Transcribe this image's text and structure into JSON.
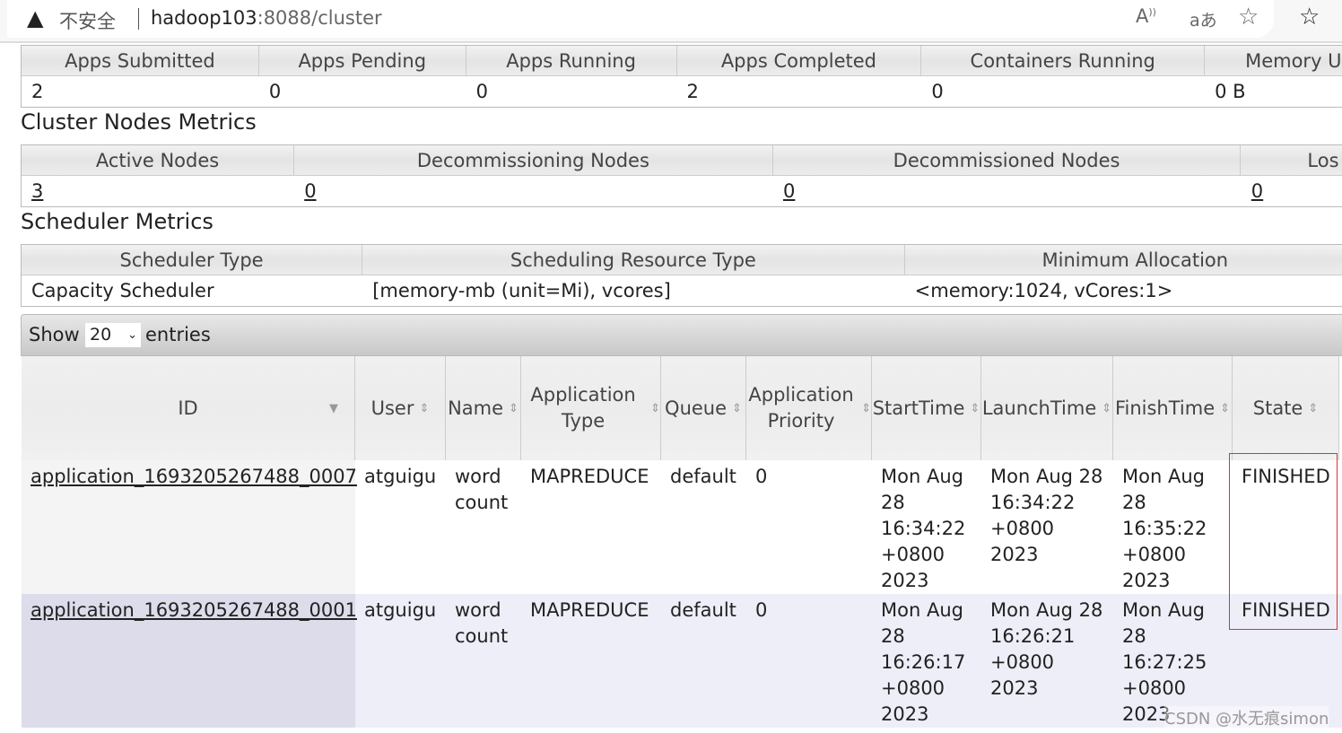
{
  "browser": {
    "security_warning": "不安全",
    "url_host": "hadoop103",
    "url_path": ":8088/cluster",
    "icons": [
      "warning-icon",
      "read-aloud-icon",
      "translate-icon",
      "add-favorite-icon",
      "favorites-icon"
    ]
  },
  "cluster_metrics": {
    "headers": [
      "Apps Submitted",
      "Apps Pending",
      "Apps Running",
      "Apps Completed",
      "Containers Running",
      "Memory U"
    ],
    "values": [
      "2",
      "0",
      "0",
      "2",
      "0",
      "0 B"
    ]
  },
  "nodes_metrics": {
    "title": "Cluster Nodes Metrics",
    "headers": [
      "Active Nodes",
      "Decommissioning Nodes",
      "Decommissioned Nodes",
      "Los"
    ],
    "values": [
      "3",
      "0",
      "0",
      "0"
    ]
  },
  "scheduler_metrics": {
    "title": "Scheduler Metrics",
    "headers": [
      "Scheduler Type",
      "Scheduling Resource Type",
      "Minimum Allocation"
    ],
    "values": [
      "Capacity Scheduler",
      "[memory-mb (unit=Mi), vcores]",
      "<memory:1024, vCores:1>"
    ]
  },
  "entries": {
    "show_label": "Show",
    "selected": "20",
    "entries_label": "entries"
  },
  "apps_table": {
    "headers": [
      "ID",
      "User",
      "Name",
      "Application Type",
      "Queue",
      "Application Priority",
      "StartTime",
      "LaunchTime",
      "FinishTime",
      "State"
    ],
    "rows": [
      [
        "application_1693205267488_0007",
        "atguigu",
        "word count",
        "MAPREDUCE",
        "default",
        "0",
        "Mon Aug 28 16:34:22 +0800 2023",
        "Mon Aug 28 16:34:22 +0800 2023",
        "Mon Aug 28 16:35:22 +0800 2023",
        "FINISHED"
      ],
      [
        "application_1693205267488_0001",
        "atguigu",
        "word count",
        "MAPREDUCE",
        "default",
        "0",
        "Mon Aug 28 16:26:17 +0800 2023",
        "Mon Aug 28 16:26:21 +0800 2023",
        "Mon Aug 28 16:27:25 +0800 2023",
        "FINISHED"
      ]
    ]
  },
  "watermark": "CSDN @水无痕simon",
  "colors": {
    "highlight_box": "#e03030",
    "row_alt": "#eeeef8"
  }
}
